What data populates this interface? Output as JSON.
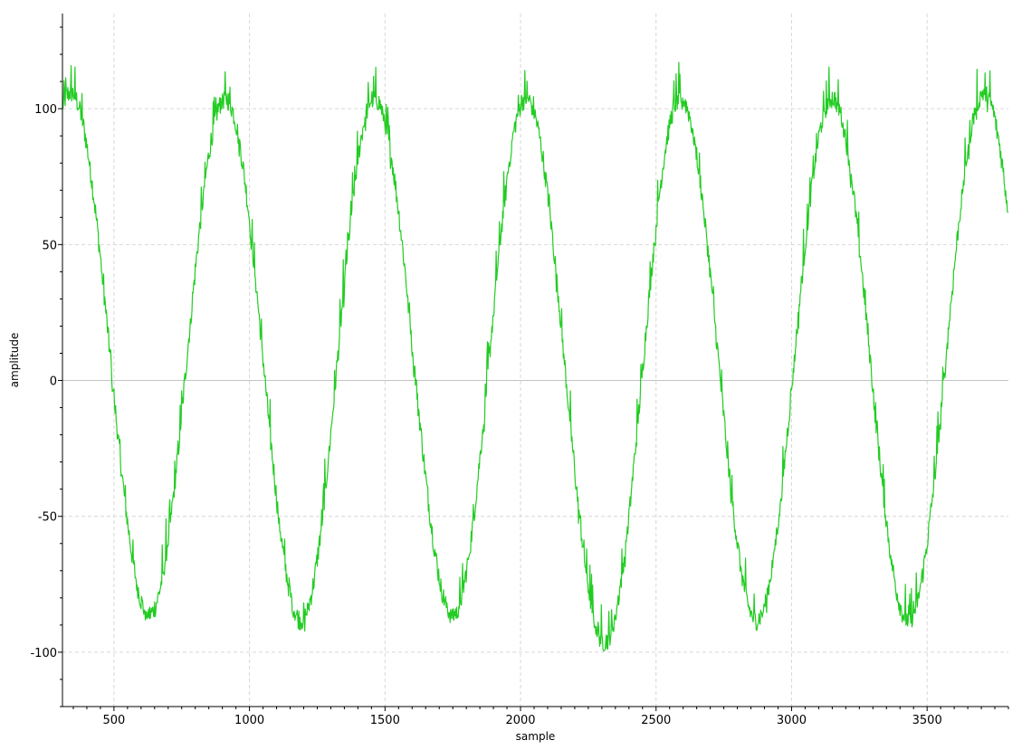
{
  "chart_data": {
    "type": "line",
    "xlabel": "sample",
    "ylabel": "amplitude",
    "xlim": [
      310,
      3800
    ],
    "ylim": [
      -120,
      135
    ],
    "x_ticks": [
      500,
      1000,
      1500,
      2000,
      2500,
      3000,
      3500
    ],
    "y_ticks": [
      -100,
      -50,
      0,
      50,
      100
    ],
    "x_tick_labels": [
      "500",
      "1000",
      "1500",
      "2000",
      "2500",
      "3000",
      "3500"
    ],
    "y_tick_labels": [
      "-100",
      "-50",
      "0",
      "50",
      "100"
    ],
    "grid": true,
    "legend": "none",
    "series": [
      {
        "color": "#22cc22",
        "description_of_signal": "noisy sine wave",
        "amplitude": 92,
        "offset": 6,
        "period": 560,
        "peaks_x": [
          340,
          910,
          1460,
          2020,
          2590,
          3150,
          3710
        ],
        "troughs_x": [
          630,
          1190,
          1750,
          2310,
          2870,
          3430
        ],
        "peak_values_approx": [
          106,
          104,
          104,
          104,
          104,
          104,
          106
        ],
        "trough_values_approx": [
          -86,
          -88,
          -86,
          -96,
          -88,
          -88
        ],
        "noise_amplitude": 10,
        "first_sample": 310,
        "last_sample": 3800,
        "last_value": 62
      }
    ]
  }
}
